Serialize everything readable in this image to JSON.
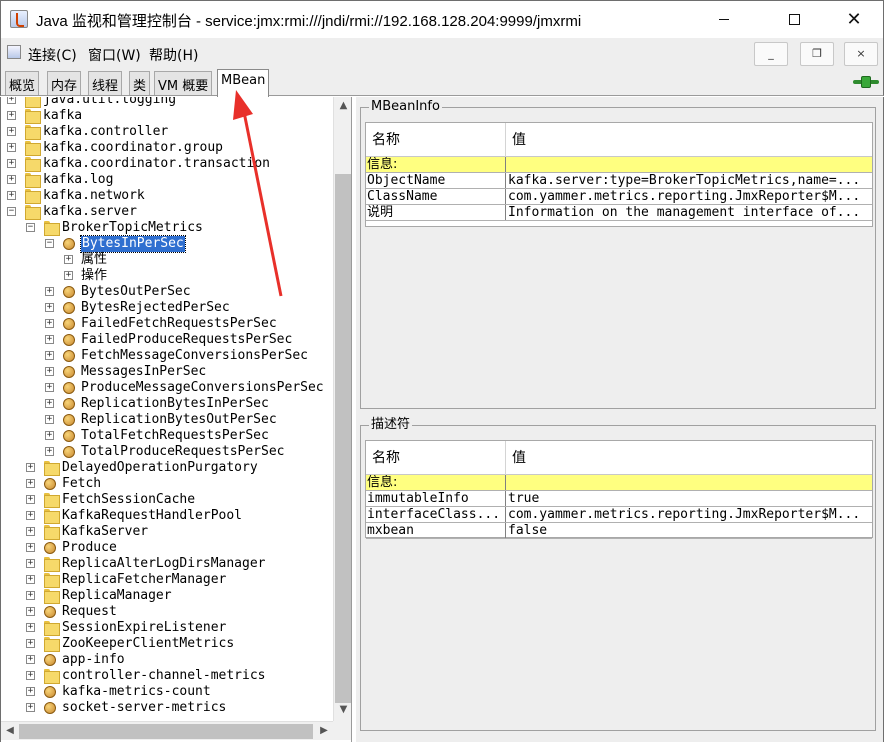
{
  "window": {
    "title": "Java 监视和管理控制台 - service:jmx:rmi:///jndi/rmi://192.168.128.204:9999/jmxrmi",
    "min_glyph": "—",
    "max_glyph": "☐",
    "close_glyph": "✕"
  },
  "menubar": {
    "items": [
      "连接(C)",
      "窗口(W)",
      "帮助(H)"
    ],
    "mdi": {
      "minimize": "_",
      "restore": "❐",
      "close": "×"
    }
  },
  "tabs": [
    "概览",
    "内存",
    "线程",
    "类",
    "VM 概要",
    "MBean"
  ],
  "active_tab": "MBean",
  "tree": {
    "rows": [
      {
        "label": "java.util.logging",
        "type": "folder",
        "level": 0,
        "expanded": false
      },
      {
        "label": "kafka",
        "type": "folder",
        "level": 0,
        "expanded": false
      },
      {
        "label": "kafka.controller",
        "type": "folder",
        "level": 0,
        "expanded": false
      },
      {
        "label": "kafka.coordinator.group",
        "type": "folder",
        "level": 0,
        "expanded": false
      },
      {
        "label": "kafka.coordinator.transaction",
        "type": "folder",
        "level": 0,
        "expanded": false
      },
      {
        "label": "kafka.log",
        "type": "folder",
        "level": 0,
        "expanded": false
      },
      {
        "label": "kafka.network",
        "type": "folder",
        "level": 0,
        "expanded": false
      },
      {
        "label": "kafka.server",
        "type": "folder",
        "level": 0,
        "expanded": true
      },
      {
        "label": "BrokerTopicMetrics",
        "type": "folder",
        "level": 1,
        "expanded": true
      },
      {
        "label": "BytesInPerSec",
        "type": "bean",
        "level": 2,
        "expanded": true,
        "selected": true
      },
      {
        "label": "属性",
        "type": "none",
        "level": 3,
        "expanded": false
      },
      {
        "label": "操作",
        "type": "none",
        "level": 3,
        "expanded": false
      },
      {
        "label": "BytesOutPerSec",
        "type": "bean",
        "level": 2,
        "expanded": false
      },
      {
        "label": "BytesRejectedPerSec",
        "type": "bean",
        "level": 2,
        "expanded": false
      },
      {
        "label": "FailedFetchRequestsPerSec",
        "type": "bean",
        "level": 2,
        "expanded": false
      },
      {
        "label": "FailedProduceRequestsPerSec",
        "type": "bean",
        "level": 2,
        "expanded": false
      },
      {
        "label": "FetchMessageConversionsPerSec",
        "type": "bean",
        "level": 2,
        "expanded": false
      },
      {
        "label": "MessagesInPerSec",
        "type": "bean",
        "level": 2,
        "expanded": false
      },
      {
        "label": "ProduceMessageConversionsPerSec",
        "type": "bean",
        "level": 2,
        "expanded": false
      },
      {
        "label": "ReplicationBytesInPerSec",
        "type": "bean",
        "level": 2,
        "expanded": false
      },
      {
        "label": "ReplicationBytesOutPerSec",
        "type": "bean",
        "level": 2,
        "expanded": false
      },
      {
        "label": "TotalFetchRequestsPerSec",
        "type": "bean",
        "level": 2,
        "expanded": false
      },
      {
        "label": "TotalProduceRequestsPerSec",
        "type": "bean",
        "level": 2,
        "expanded": false
      },
      {
        "label": "DelayedOperationPurgatory",
        "type": "folder",
        "level": 1,
        "expanded": false
      },
      {
        "label": "Fetch",
        "type": "bean",
        "level": 1,
        "expanded": false
      },
      {
        "label": "FetchSessionCache",
        "type": "folder",
        "level": 1,
        "expanded": false
      },
      {
        "label": "KafkaRequestHandlerPool",
        "type": "folder",
        "level": 1,
        "expanded": false
      },
      {
        "label": "KafkaServer",
        "type": "folder",
        "level": 1,
        "expanded": false
      },
      {
        "label": "Produce",
        "type": "bean",
        "level": 1,
        "expanded": false
      },
      {
        "label": "ReplicaAlterLogDirsManager",
        "type": "folder",
        "level": 1,
        "expanded": false
      },
      {
        "label": "ReplicaFetcherManager",
        "type": "folder",
        "level": 1,
        "expanded": false
      },
      {
        "label": "ReplicaManager",
        "type": "folder",
        "level": 1,
        "expanded": false
      },
      {
        "label": "Request",
        "type": "bean",
        "level": 1,
        "expanded": false
      },
      {
        "label": "SessionExpireListener",
        "type": "folder",
        "level": 1,
        "expanded": false
      },
      {
        "label": "ZooKeeperClientMetrics",
        "type": "folder",
        "level": 1,
        "expanded": false
      },
      {
        "label": "app-info",
        "type": "bean",
        "level": 1,
        "expanded": false
      },
      {
        "label": "controller-channel-metrics",
        "type": "folder",
        "level": 1,
        "expanded": false
      },
      {
        "label": "kafka-metrics-count",
        "type": "bean",
        "level": 1,
        "expanded": false
      },
      {
        "label": "socket-server-metrics",
        "type": "bean",
        "level": 1,
        "expanded": false
      }
    ]
  },
  "mbean_info": {
    "title": "MBeanInfo",
    "headers": [
      "名称",
      "值"
    ],
    "section": "信息:",
    "rows": [
      [
        "ObjectName",
        "kafka.server:type=BrokerTopicMetrics,name=..."
      ],
      [
        "ClassName",
        "com.yammer.metrics.reporting.JmxReporter$M..."
      ],
      [
        "说明",
        "Information on the management interface of..."
      ]
    ]
  },
  "descriptor": {
    "title": "描述符",
    "headers": [
      "名称",
      "值"
    ],
    "section": "信息:",
    "rows": [
      [
        "immutableInfo",
        "true"
      ],
      [
        "interfaceClass...",
        "com.yammer.metrics.reporting.JmxReporter$M..."
      ],
      [
        "mxbean",
        "false"
      ]
    ]
  },
  "colors": {
    "selection": "#2f6fd0",
    "info_row": "#ffff80",
    "annotation_arrow": "#e8302a"
  }
}
